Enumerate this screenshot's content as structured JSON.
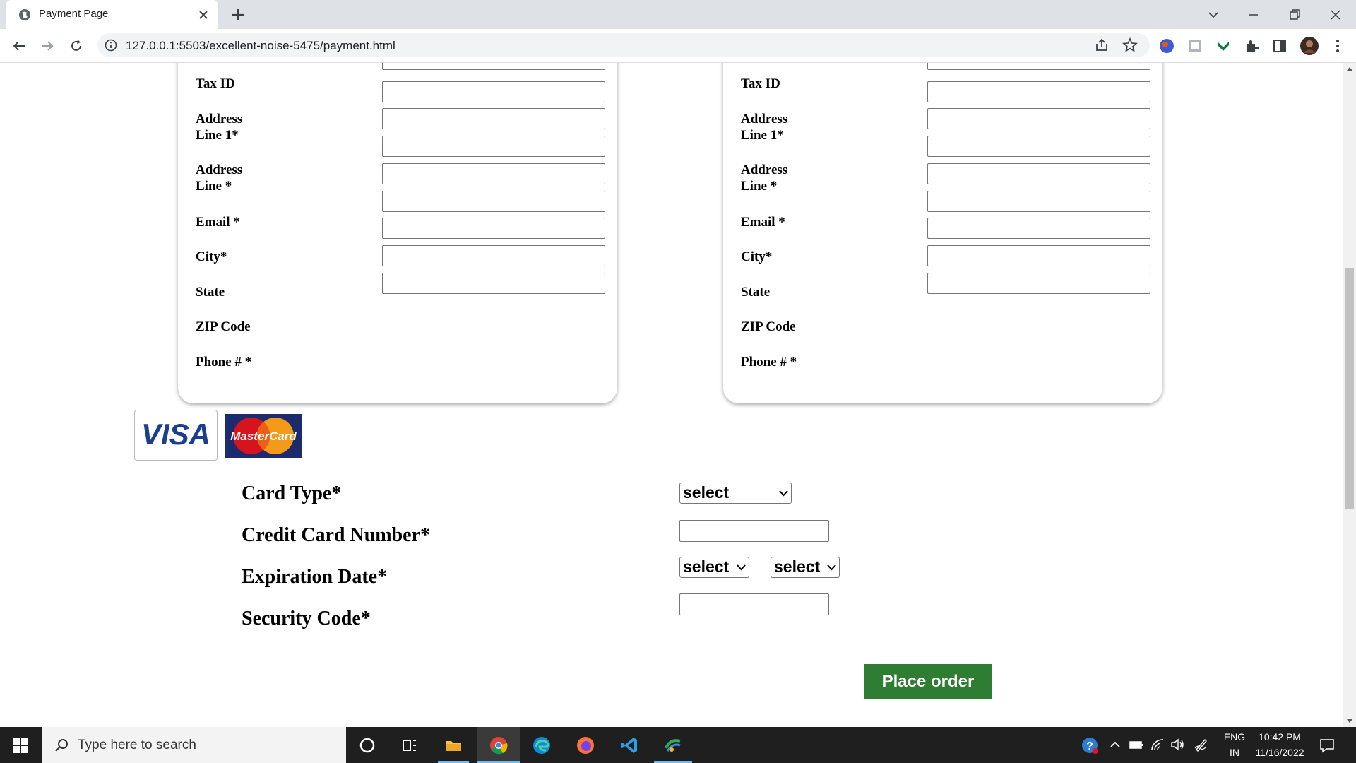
{
  "browser": {
    "tab_title": "Payment Page",
    "url": "127.0.0.1:5503/excellent-noise-5475/payment.html"
  },
  "billing": {
    "labels": {
      "tax_id": "Tax ID",
      "address1": "Address Line 1*",
      "address2": "Address Line *",
      "email": "Email *",
      "city": "City*",
      "state": "State",
      "zip": "ZIP Code",
      "phone": "Phone # *"
    }
  },
  "shipping": {
    "labels": {
      "tax_id": "Tax ID",
      "address1": "Address Line 1*",
      "address2": "Address Line *",
      "email": "Email *",
      "city": "City*",
      "state": "State",
      "zip": "ZIP Code",
      "phone": "Phone # *"
    }
  },
  "payment": {
    "logos": {
      "visa": "VISA",
      "mastercard": "MasterCard"
    },
    "card_type_label": "Card Type*",
    "card_number_label": "Credit Card Number*",
    "expiration_label": "Expiration Date*",
    "security_label": "Security Code*",
    "card_type_value": "select",
    "exp_month_value": "select",
    "exp_year_value": "select",
    "place_order": "Place order"
  },
  "taskbar": {
    "search_placeholder": "Type here to search",
    "lang": "ENG",
    "region": "IN",
    "time": "10:42 PM",
    "date": "11/16/2022"
  },
  "colors": {
    "accent": "#2e7d32",
    "tabbar": "#dee1e6",
    "taskbar": "#1f1f1f"
  }
}
